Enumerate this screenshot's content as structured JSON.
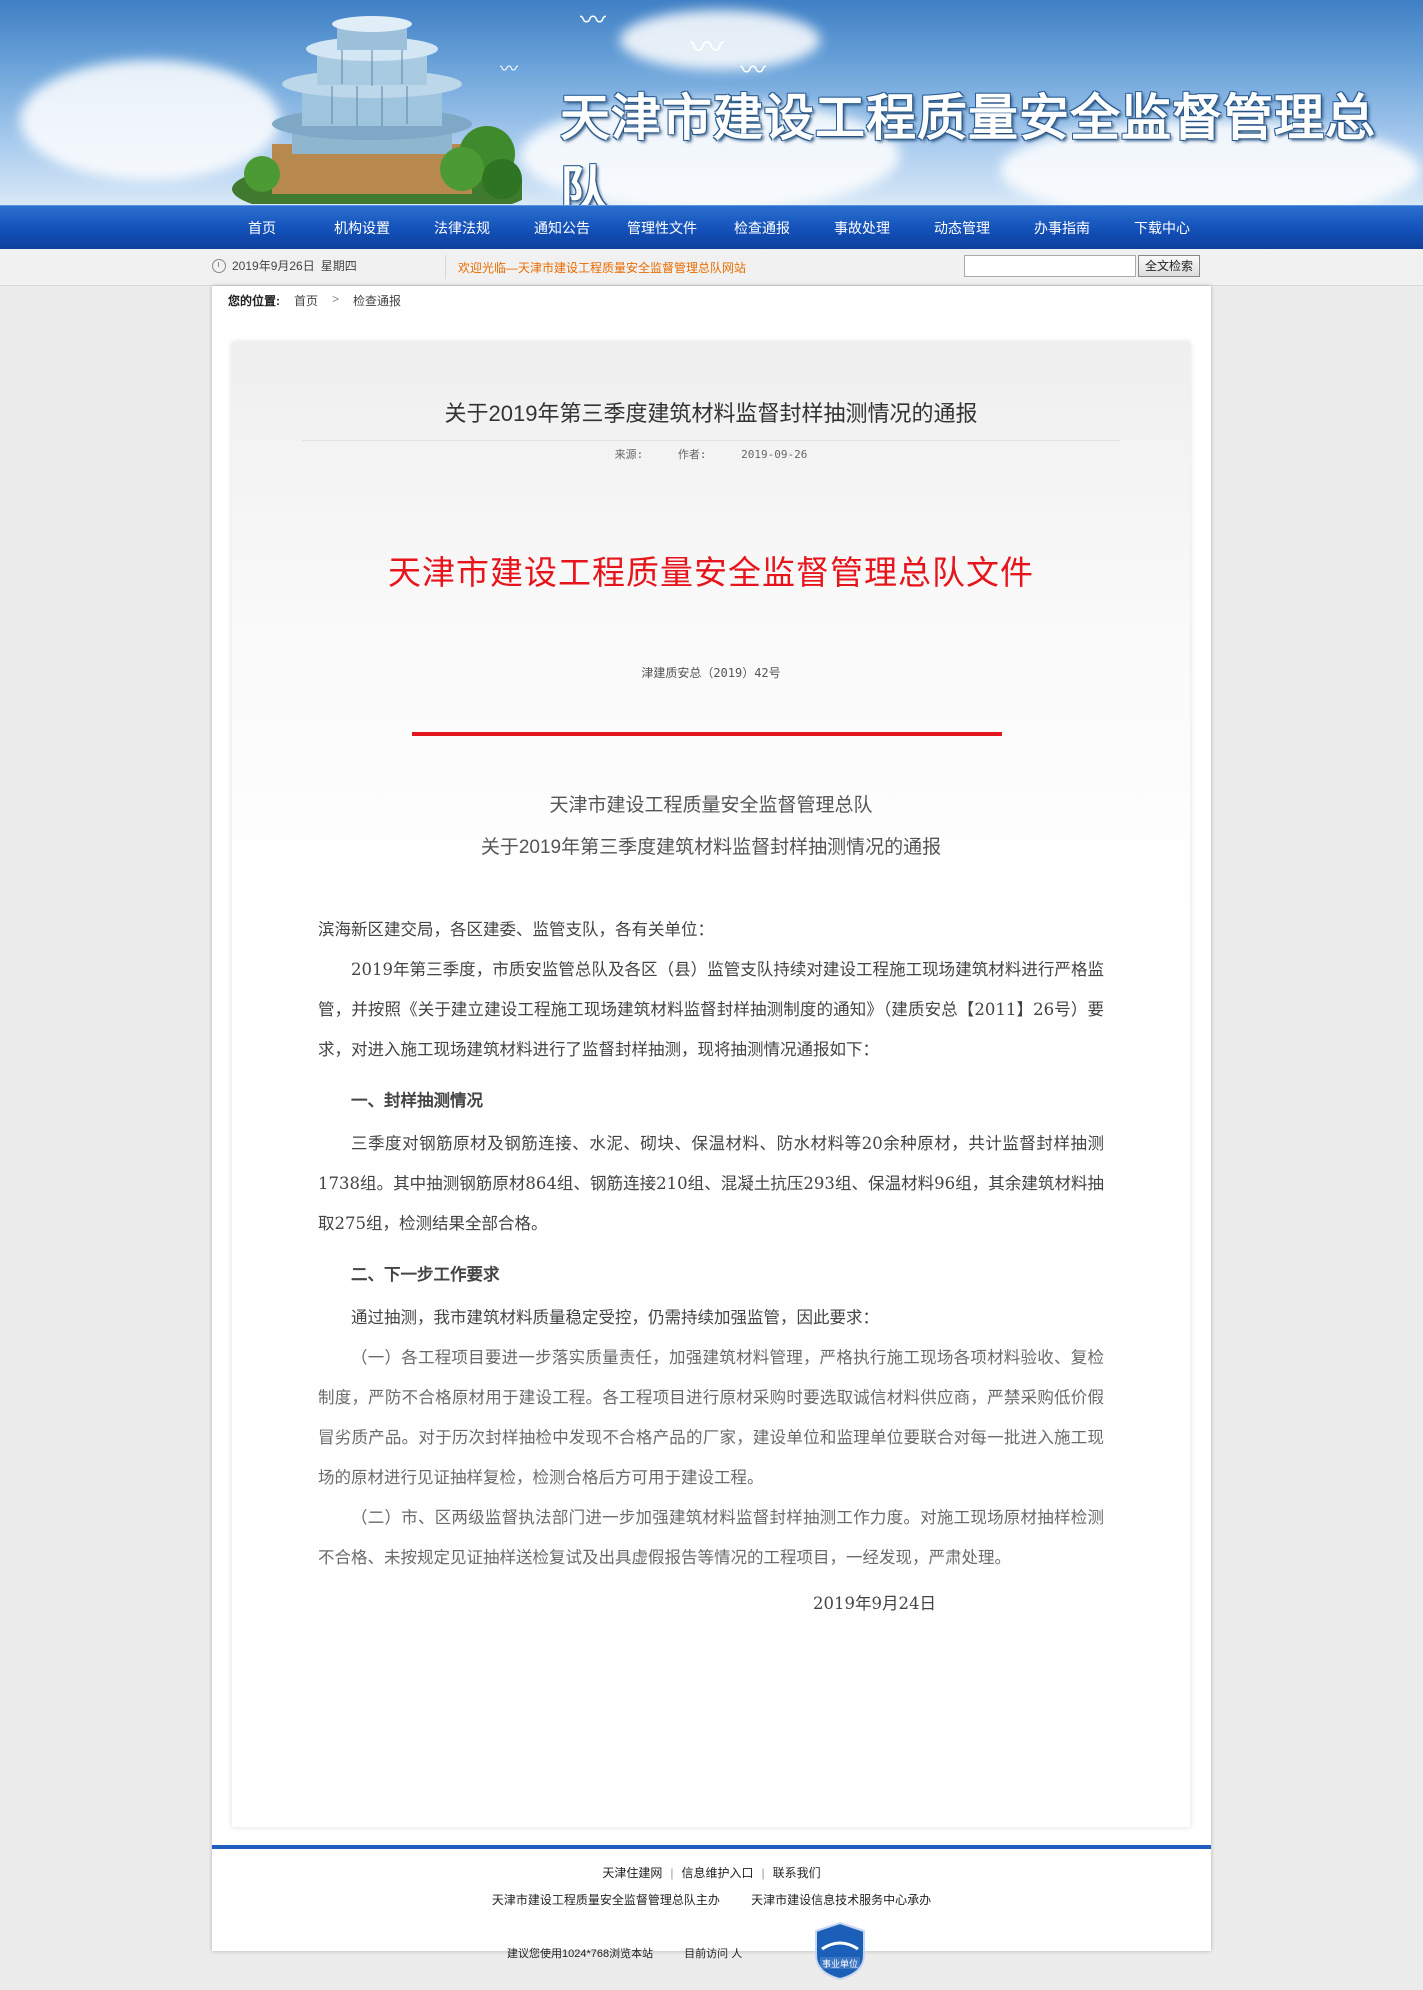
{
  "header": {
    "site_title": "天津市建设工程质量安全监督管理总队"
  },
  "nav": {
    "items": [
      "首页",
      "机构设置",
      "法律法规",
      "通知公告",
      "管理性文件",
      "检查通报",
      "事故处理",
      "动态管理",
      "办事指南",
      "下载中心"
    ]
  },
  "infobar": {
    "date": "2019年9月26日",
    "weekday": "星期四",
    "welcome": "欢迎光临—天津市建设工程质量安全监督管理总队网站",
    "search_value": "",
    "search_button": "全文检索"
  },
  "breadcrumb": {
    "label": "您的位置:",
    "items": [
      "首页",
      "检查通报"
    ],
    "separator": ">"
  },
  "article": {
    "title": "关于2019年第三季度建筑材料监督封样抽测情况的通报",
    "source_label": "来源:",
    "author_label": "作者:",
    "date": "2019-09-26",
    "red_heading": "天津市建设工程质量安全监督管理总队文件",
    "doc_number": "津建质安总（2019）42号",
    "issuer": "天津市建设工程质量安全监督管理总队",
    "subtitle": "关于2019年第三季度建筑材料监督封样抽测情况的通报",
    "salutation": "滨海新区建交局，各区建委、监管支队，各有关单位：",
    "para1": "2019年第三季度，市质安监管总队及各区（县）监管支队持续对建设工程施工现场建筑材料进行严格监管，并按照《关于建立建设工程施工现场建筑材料监督封样抽测制度的通知》（建质安总【2011】26号）要求，对进入施工现场建筑材料进行了监督封样抽测，现将抽测情况通报如下：",
    "section1": "一、封样抽测情况",
    "para2": "三季度对钢筋原材及钢筋连接、水泥、砌块、保温材料、防水材料等20余种原材，共计监督封样抽测1738组。其中抽测钢筋原材864组、钢筋连接210组、混凝土抗压293组、保温材料96组，其余建筑材料抽取275组，检测结果全部合格。",
    "section2": "二、下一步工作要求",
    "para3": "通过抽测，我市建筑材料质量稳定受控，仍需持续加强监管，因此要求：",
    "para4": "（一）各工程项目要进一步落实质量责任，加强建筑材料管理，严格执行施工现场各项材料验收、复检制度，严防不合格原材用于建设工程。各工程项目进行原材采购时要选取诚信材料供应商，严禁采购低价假冒劣质产品。对于历次封样抽检中发现不合格产品的厂家，建设单位和监理单位要联合对每一批进入施工现场的原材进行见证抽样复检，检测合格后方可用于建设工程。",
    "para5": "（二）市、区两级监督执法部门进一步加强建筑材料监督封样抽测工作力度。对施工现场原材抽样检测不合格、未按规定见证抽样送检复试及出具虚假报告等情况的工程项目，一经发现，严肃处理。",
    "sign_date": "2019年9月24日"
  },
  "footer": {
    "links": [
      "天津住建网",
      "信息维护入口",
      "联系我们"
    ],
    "host": "天津市建设工程质量安全监督管理总队主办",
    "support": "天津市建设信息技术服务中心承办",
    "browser_tip": "建议您使用1024*768浏览本站",
    "visits": "目前访问  人",
    "badge_text": "事业单位"
  },
  "colors": {
    "nav_blue": "#1350b8",
    "red": "#e8141c",
    "orange": "#ea6c00"
  }
}
